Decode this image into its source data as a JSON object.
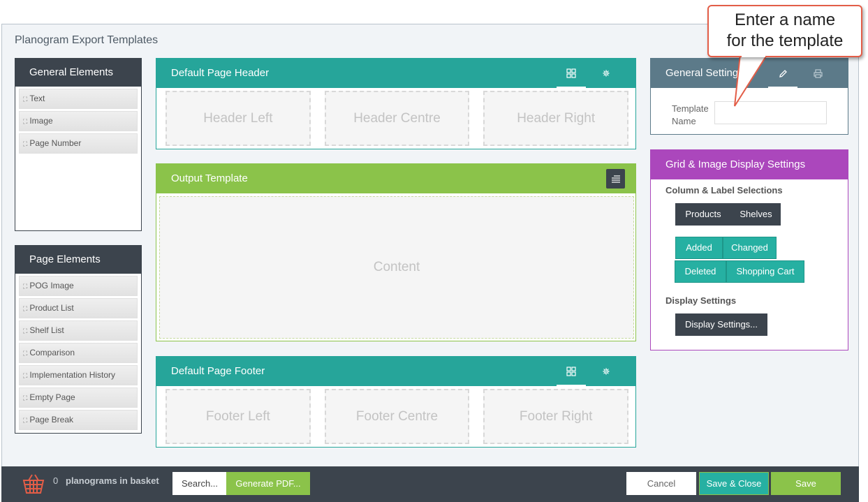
{
  "page": {
    "title": "Planogram Export Templates"
  },
  "general_elements": {
    "title": "General Elements",
    "items": [
      {
        "label": "Text"
      },
      {
        "label": "Image"
      },
      {
        "label": "Page Number"
      }
    ]
  },
  "page_elements": {
    "title": "Page Elements",
    "items": [
      {
        "label": "POG Image"
      },
      {
        "label": "Product List"
      },
      {
        "label": "Shelf List"
      },
      {
        "label": "Comparison"
      },
      {
        "label": "Implementation History"
      },
      {
        "label": "Empty Page"
      },
      {
        "label": "Page Break"
      }
    ]
  },
  "header_section": {
    "title": "Default Page Header",
    "zones": [
      "Header Left",
      "Header Centre",
      "Header Right"
    ]
  },
  "output_section": {
    "title": "Output Template",
    "content": "Content"
  },
  "footer_section": {
    "title": "Default Page Footer",
    "zones": [
      "Footer Left",
      "Footer Centre",
      "Footer Right"
    ]
  },
  "general_settings": {
    "title": "General Settings",
    "template_name_label_1": "Template",
    "template_name_label_2": "Name",
    "template_name_value": ""
  },
  "grid_settings": {
    "title": "Grid & Image Display Settings",
    "column_label_heading": "Column & Label Selections",
    "col_buttons": [
      "Products",
      "Shelves"
    ],
    "status_buttons": [
      "Added",
      "Changed",
      "Deleted",
      "Shopping Cart"
    ],
    "display_heading": "Display Settings",
    "display_button": "Display Settings..."
  },
  "bottom_bar": {
    "basket_count": "0",
    "basket_text": "planograms in basket",
    "search_label": "Search...",
    "generate_pdf_label": "Generate PDF...",
    "cancel_label": "Cancel",
    "save_close_label": "Save & Close",
    "save_label": "Save"
  },
  "callout": {
    "line1": "Enter a name",
    "line2": "for the template"
  },
  "colors": {
    "dark": "#3c444d",
    "teal": "#26a59a",
    "green": "#8bc34a",
    "slate": "#5c7a89",
    "purple": "#ab47bc",
    "callout_border": "#e35d47"
  },
  "icons": {
    "drag_handle": "move-icon",
    "layout": "grid-icon",
    "settings": "cog-icon",
    "edit": "pencil-icon",
    "print": "printer-icon",
    "basket": "basket-icon"
  }
}
